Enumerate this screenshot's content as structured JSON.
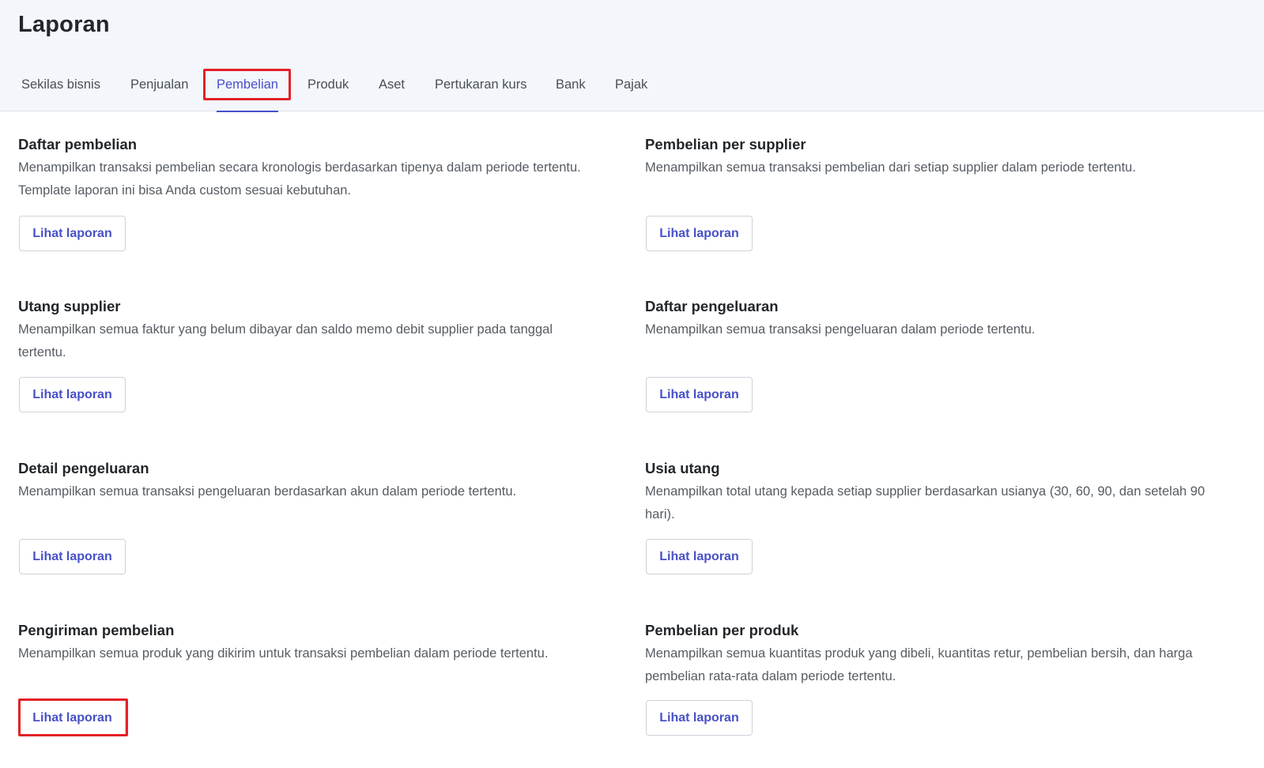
{
  "header": {
    "title": "Laporan"
  },
  "tabs": [
    {
      "label": "Sekilas bisnis",
      "active": false
    },
    {
      "label": "Penjualan",
      "active": false
    },
    {
      "label": "Pembelian",
      "active": true
    },
    {
      "label": "Produk",
      "active": false
    },
    {
      "label": "Aset",
      "active": false
    },
    {
      "label": "Pertukaran kurs",
      "active": false
    },
    {
      "label": "Bank",
      "active": false
    },
    {
      "label": "Pajak",
      "active": false
    }
  ],
  "reports": [
    {
      "title": "Daftar pembelian",
      "description": "Menampilkan transaksi pembelian secara kronologis berdasarkan tipenya dalam periode tertentu. Template laporan ini bisa Anda custom sesuai kebutuhan.",
      "button": "Lihat laporan"
    },
    {
      "title": "Pembelian per supplier",
      "description": "Menampilkan semua transaksi pembelian dari setiap supplier dalam periode tertentu.",
      "button": "Lihat laporan"
    },
    {
      "title": "Utang supplier",
      "description": "Menampilkan semua faktur yang belum dibayar dan saldo memo debit supplier pada tanggal tertentu.",
      "button": "Lihat laporan"
    },
    {
      "title": "Daftar pengeluaran",
      "description": "Menampilkan semua transaksi pengeluaran dalam periode tertentu.",
      "button": "Lihat laporan"
    },
    {
      "title": "Detail pengeluaran",
      "description": "Menampilkan semua transaksi pengeluaran berdasarkan akun dalam periode tertentu.",
      "button": "Lihat laporan"
    },
    {
      "title": "Usia utang",
      "description": "Menampilkan total utang kepada setiap supplier berdasarkan usianya (30, 60, 90, dan setelah 90 hari).",
      "button": "Lihat laporan"
    },
    {
      "title": "Pengiriman pembelian",
      "description": "Menampilkan semua produk yang dikirim untuk transaksi pembelian dalam periode tertentu.",
      "button": "Lihat laporan"
    },
    {
      "title": "Pembelian per produk",
      "description": "Menampilkan semua kuantitas produk yang dibeli, kuantitas retur, pembelian bersih, dan harga pembelian rata-rata dalam periode tertentu.",
      "button": "Lihat laporan"
    }
  ],
  "colors": {
    "accent": "#4750c7",
    "highlight": "#e32127",
    "header_bg": "#f3f6fb"
  }
}
